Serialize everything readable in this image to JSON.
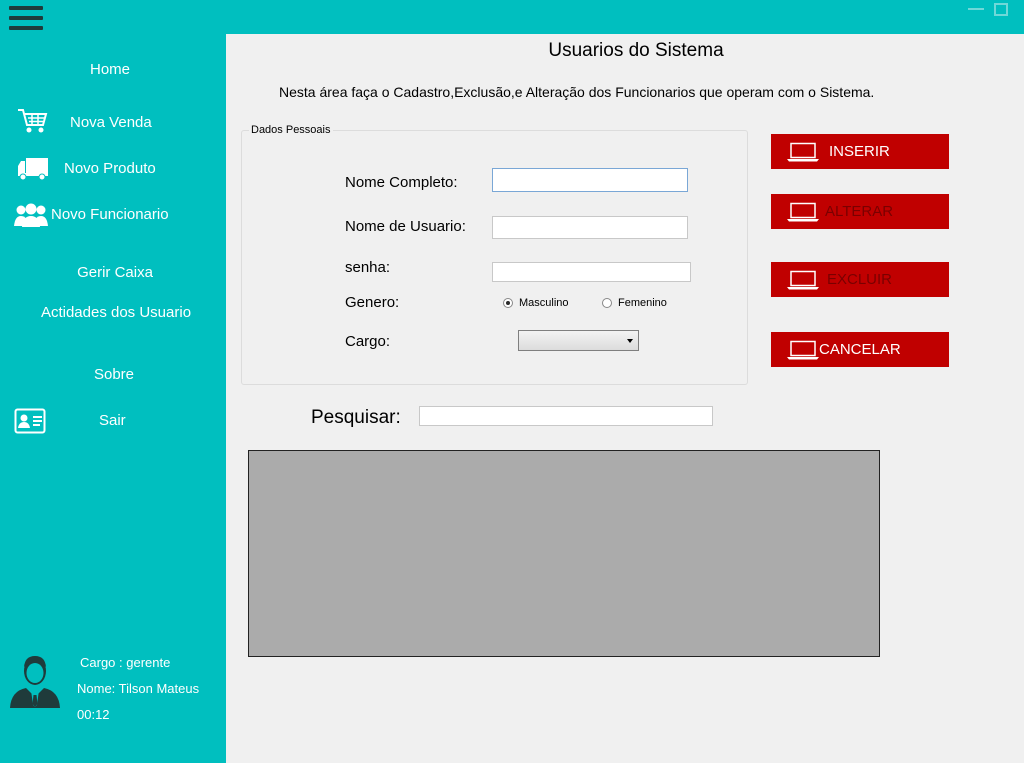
{
  "window": {
    "menu_icon": "hamburger-menu-icon",
    "minimize_icon": "minimize-icon",
    "maximize_icon": "maximize-icon"
  },
  "sidebar": {
    "home": "Home",
    "nova_venda": "Nova Venda",
    "novo_produto": "Novo Produto",
    "novo_funcionario": "Novo Funcionario",
    "gerir_caixa": "Gerir Caixa",
    "actividades": "Actidades dos Usuario",
    "sobre": "Sobre",
    "sair": "Sair",
    "icons": {
      "nova_venda": "cart-icon",
      "novo_produto": "truck-icon",
      "novo_funcionario": "users-icon",
      "sair": "id-card-icon"
    },
    "user": {
      "avatar_icon": "user-avatar-icon",
      "cargo": "Cargo : gerente",
      "nome": "Nome: Tilson Mateus",
      "hora": "00:12"
    }
  },
  "main": {
    "title": "Usuarios do Sistema",
    "description": "Nesta área faça o Cadastro,Exclusão,e Alteração dos Funcionarios que operam com o Sistema.",
    "form": {
      "legend": "Dados Pessoais",
      "nome_completo_label": "Nome Completo:",
      "nome_completo_value": "",
      "nome_usuario_label": "Nome de Usuario:",
      "nome_usuario_value": "",
      "senha_label": "senha:",
      "senha_value": "",
      "genero_label": "Genero:",
      "genero_options": [
        "Masculino",
        "Femenino"
      ],
      "genero_selected": "Masculino",
      "cargo_label": "Cargo:",
      "cargo_value": ""
    },
    "buttons": {
      "inserir": "INSERIR",
      "alterar": "ALTERAR",
      "excluir": "EXCLUIR",
      "cancelar": "CANCELAR",
      "icon": "laptop-icon"
    },
    "search": {
      "label": "Pesquisar:",
      "value": ""
    }
  },
  "colors": {
    "sidebar_bg": "#00bfbf",
    "button_bg": "#c00000",
    "grid_bg": "#ababab"
  }
}
